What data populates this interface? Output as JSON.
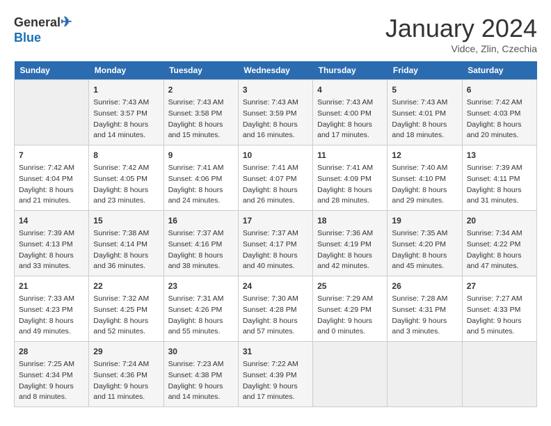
{
  "header": {
    "logo_line1": "General",
    "logo_line2": "Blue",
    "month_title": "January 2024",
    "subtitle": "Vidce, Zlin, Czechia"
  },
  "days_of_week": [
    "Sunday",
    "Monday",
    "Tuesday",
    "Wednesday",
    "Thursday",
    "Friday",
    "Saturday"
  ],
  "weeks": [
    [
      {
        "day": "",
        "info": ""
      },
      {
        "day": "1",
        "info": "Sunrise: 7:43 AM\nSunset: 3:57 PM\nDaylight: 8 hours\nand 14 minutes."
      },
      {
        "day": "2",
        "info": "Sunrise: 7:43 AM\nSunset: 3:58 PM\nDaylight: 8 hours\nand 15 minutes."
      },
      {
        "day": "3",
        "info": "Sunrise: 7:43 AM\nSunset: 3:59 PM\nDaylight: 8 hours\nand 16 minutes."
      },
      {
        "day": "4",
        "info": "Sunrise: 7:43 AM\nSunset: 4:00 PM\nDaylight: 8 hours\nand 17 minutes."
      },
      {
        "day": "5",
        "info": "Sunrise: 7:43 AM\nSunset: 4:01 PM\nDaylight: 8 hours\nand 18 minutes."
      },
      {
        "day": "6",
        "info": "Sunrise: 7:42 AM\nSunset: 4:03 PM\nDaylight: 8 hours\nand 20 minutes."
      }
    ],
    [
      {
        "day": "7",
        "info": "Sunrise: 7:42 AM\nSunset: 4:04 PM\nDaylight: 8 hours\nand 21 minutes."
      },
      {
        "day": "8",
        "info": "Sunrise: 7:42 AM\nSunset: 4:05 PM\nDaylight: 8 hours\nand 23 minutes."
      },
      {
        "day": "9",
        "info": "Sunrise: 7:41 AM\nSunset: 4:06 PM\nDaylight: 8 hours\nand 24 minutes."
      },
      {
        "day": "10",
        "info": "Sunrise: 7:41 AM\nSunset: 4:07 PM\nDaylight: 8 hours\nand 26 minutes."
      },
      {
        "day": "11",
        "info": "Sunrise: 7:41 AM\nSunset: 4:09 PM\nDaylight: 8 hours\nand 28 minutes."
      },
      {
        "day": "12",
        "info": "Sunrise: 7:40 AM\nSunset: 4:10 PM\nDaylight: 8 hours\nand 29 minutes."
      },
      {
        "day": "13",
        "info": "Sunrise: 7:39 AM\nSunset: 4:11 PM\nDaylight: 8 hours\nand 31 minutes."
      }
    ],
    [
      {
        "day": "14",
        "info": "Sunrise: 7:39 AM\nSunset: 4:13 PM\nDaylight: 8 hours\nand 33 minutes."
      },
      {
        "day": "15",
        "info": "Sunrise: 7:38 AM\nSunset: 4:14 PM\nDaylight: 8 hours\nand 36 minutes."
      },
      {
        "day": "16",
        "info": "Sunrise: 7:37 AM\nSunset: 4:16 PM\nDaylight: 8 hours\nand 38 minutes."
      },
      {
        "day": "17",
        "info": "Sunrise: 7:37 AM\nSunset: 4:17 PM\nDaylight: 8 hours\nand 40 minutes."
      },
      {
        "day": "18",
        "info": "Sunrise: 7:36 AM\nSunset: 4:19 PM\nDaylight: 8 hours\nand 42 minutes."
      },
      {
        "day": "19",
        "info": "Sunrise: 7:35 AM\nSunset: 4:20 PM\nDaylight: 8 hours\nand 45 minutes."
      },
      {
        "day": "20",
        "info": "Sunrise: 7:34 AM\nSunset: 4:22 PM\nDaylight: 8 hours\nand 47 minutes."
      }
    ],
    [
      {
        "day": "21",
        "info": "Sunrise: 7:33 AM\nSunset: 4:23 PM\nDaylight: 8 hours\nand 49 minutes."
      },
      {
        "day": "22",
        "info": "Sunrise: 7:32 AM\nSunset: 4:25 PM\nDaylight: 8 hours\nand 52 minutes."
      },
      {
        "day": "23",
        "info": "Sunrise: 7:31 AM\nSunset: 4:26 PM\nDaylight: 8 hours\nand 55 minutes."
      },
      {
        "day": "24",
        "info": "Sunrise: 7:30 AM\nSunset: 4:28 PM\nDaylight: 8 hours\nand 57 minutes."
      },
      {
        "day": "25",
        "info": "Sunrise: 7:29 AM\nSunset: 4:29 PM\nDaylight: 9 hours\nand 0 minutes."
      },
      {
        "day": "26",
        "info": "Sunrise: 7:28 AM\nSunset: 4:31 PM\nDaylight: 9 hours\nand 3 minutes."
      },
      {
        "day": "27",
        "info": "Sunrise: 7:27 AM\nSunset: 4:33 PM\nDaylight: 9 hours\nand 5 minutes."
      }
    ],
    [
      {
        "day": "28",
        "info": "Sunrise: 7:25 AM\nSunset: 4:34 PM\nDaylight: 9 hours\nand 8 minutes."
      },
      {
        "day": "29",
        "info": "Sunrise: 7:24 AM\nSunset: 4:36 PM\nDaylight: 9 hours\nand 11 minutes."
      },
      {
        "day": "30",
        "info": "Sunrise: 7:23 AM\nSunset: 4:38 PM\nDaylight: 9 hours\nand 14 minutes."
      },
      {
        "day": "31",
        "info": "Sunrise: 7:22 AM\nSunset: 4:39 PM\nDaylight: 9 hours\nand 17 minutes."
      },
      {
        "day": "",
        "info": ""
      },
      {
        "day": "",
        "info": ""
      },
      {
        "day": "",
        "info": ""
      }
    ]
  ]
}
